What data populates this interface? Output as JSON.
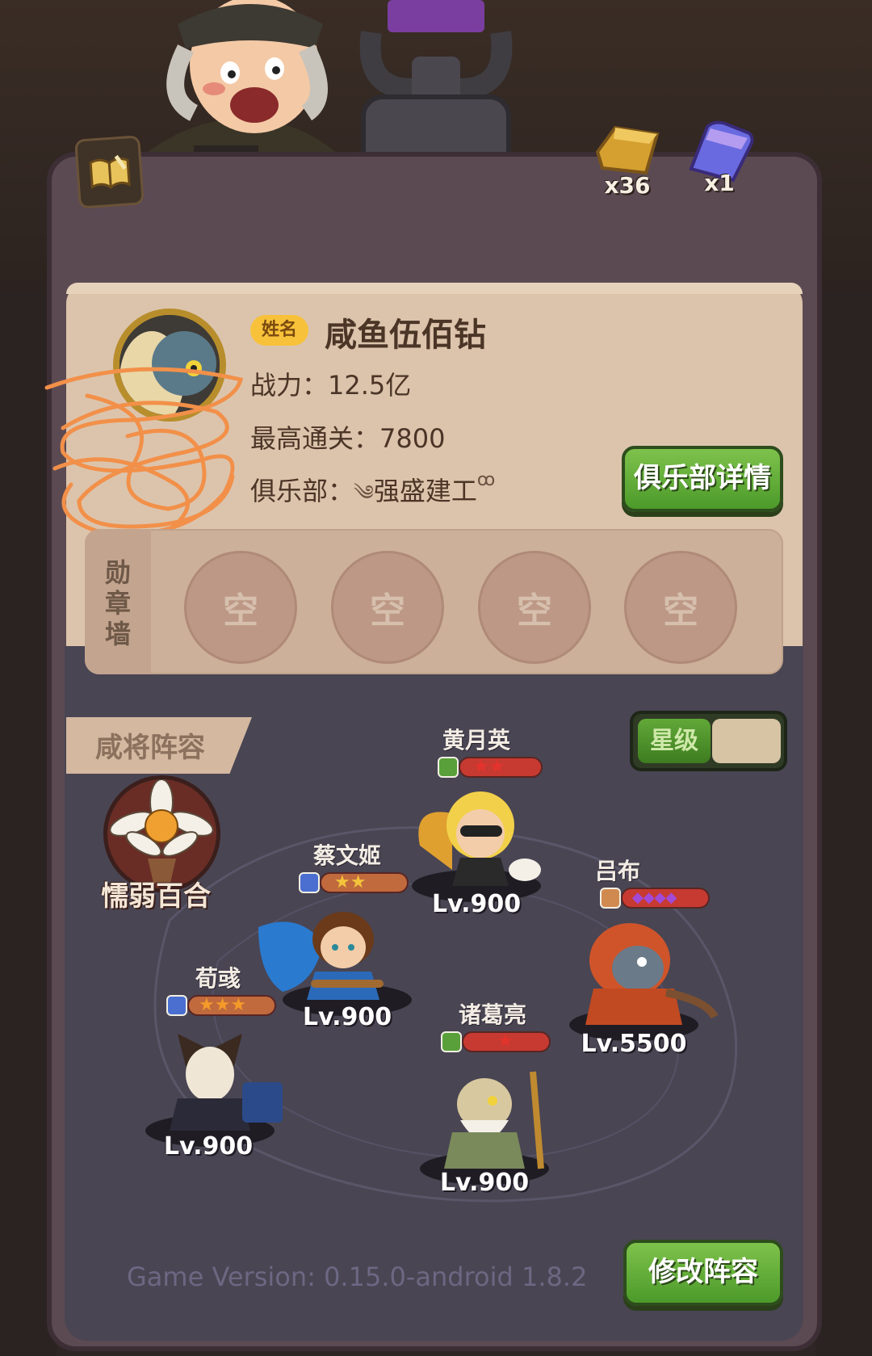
{
  "profile": {
    "name_tag": "姓名",
    "player_name": "咸鱼伍佰钻",
    "power_label": "战力：",
    "power_value": "12.5亿",
    "stage_label": "最高通关：",
    "stage_value": "7800",
    "club_label": "俱乐部：",
    "club_value": "强盛建工",
    "club_detail_button": "俱乐部详情"
  },
  "resources": [
    {
      "icon": "gold-bar-icon",
      "count": "x36"
    },
    {
      "icon": "crystal-icon",
      "count": "x1"
    }
  ],
  "medal_wall": {
    "label": "勋章墙",
    "slots": [
      "空",
      "空",
      "空",
      "空"
    ]
  },
  "lineup": {
    "title": "咸将阵容",
    "star_toggle_label": "星级",
    "pet_name": "懦弱百合",
    "heroes": [
      {
        "name": "黄月英",
        "level": "Lv.900",
        "stars": "★★",
        "badge_color": "#5aa03a",
        "star_color": "#e3332c",
        "bar_color": "#c63a32"
      },
      {
        "name": "蔡文姬",
        "level": "Lv.900",
        "stars": "★★",
        "badge_color": "#4a6fd0",
        "star_color": "#f3c43a",
        "bar_color": "#c06a3e"
      },
      {
        "name": "吕布",
        "level": "Lv.5500",
        "stars": "◆◆◆◆",
        "badge_color": "#d08a50",
        "star_color": "#a24ad8",
        "bar_color": "#c63a32"
      },
      {
        "name": "荀彧",
        "level": "Lv.900",
        "stars": "★★★",
        "badge_color": "#4a6fd0",
        "star_color": "#f39a2a",
        "bar_color": "#c06a3e"
      },
      {
        "name": "诸葛亮",
        "level": "Lv.900",
        "stars": "★",
        "badge_color": "#5aa03a",
        "star_color": "#e3332c",
        "bar_color": "#c63a32"
      }
    ],
    "edit_button": "修改阵容"
  },
  "footer": {
    "game_version": "Game Version: 0.15.0-android 1.8.2"
  }
}
